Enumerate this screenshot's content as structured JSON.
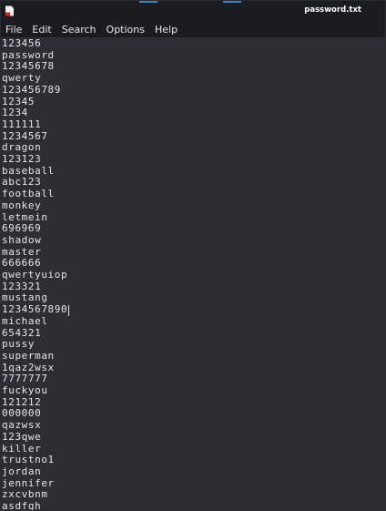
{
  "window": {
    "title": "password.txt",
    "icon": "text-editor-icon"
  },
  "menu": [
    "File",
    "Edit",
    "Search",
    "Options",
    "Help"
  ],
  "editor": {
    "lines": [
      "123456",
      "password",
      "12345678",
      "qwerty",
      "123456789",
      "12345",
      "1234",
      "111111",
      "1234567",
      "dragon",
      "123123",
      "baseball",
      "abc123",
      "football",
      "monkey",
      "letmein",
      "696969",
      "shadow",
      "master",
      "666666",
      "qwertyuiop",
      "123321",
      "mustang",
      "1234567890",
      "michael",
      "654321",
      "pussy",
      "superman",
      "1qaz2wsx",
      "7777777",
      "fuckyou",
      "121212",
      "000000",
      "qazwsx",
      "123qwe",
      "killer",
      "trustno1",
      "jordan",
      "jennifer",
      "zxcvbnm",
      "asdfgh"
    ],
    "caret_line": 23
  }
}
